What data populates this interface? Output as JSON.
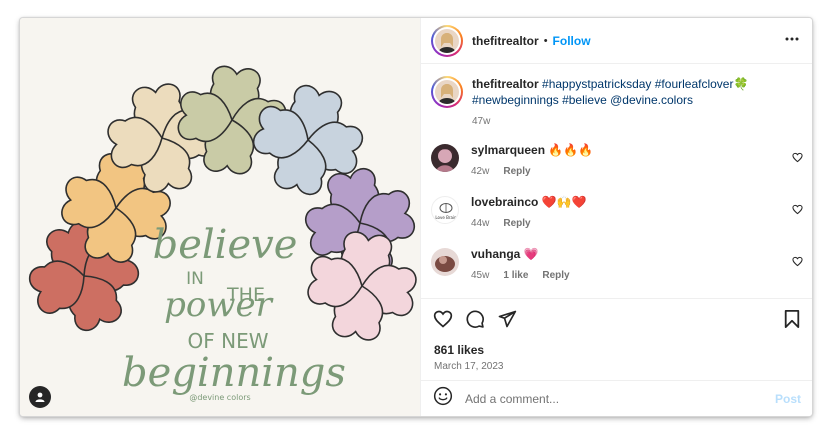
{
  "post": {
    "username": "thefitrealtor",
    "follow_label": "Follow",
    "dot": "•"
  },
  "caption": {
    "username": "thefitrealtor",
    "text": "#happystpatricksday #fourleafclover🍀 #newbeginnings #believe @devine.colors",
    "age": "47w"
  },
  "comments": [
    {
      "username": "sylmarqueen",
      "text": "🔥🔥🔥",
      "age": "42w",
      "likes": "",
      "reply_label": "Reply"
    },
    {
      "username": "lovebrainco",
      "text": "❤️🙌❤️",
      "age": "44w",
      "likes": "",
      "reply_label": "Reply",
      "avatar_text": "Love Brain"
    },
    {
      "username": "vuhanga",
      "text": "💗",
      "age": "45w",
      "likes": "1 like",
      "reply_label": "Reply"
    }
  ],
  "stats": {
    "likes": "861 likes",
    "date": "March 17, 2023"
  },
  "composer": {
    "placeholder": "Add a comment...",
    "post_label": "Post"
  },
  "artwork": {
    "line1": "believe",
    "line2_a": "IN",
    "line2_b": "THE",
    "line3": "power",
    "line4": "OF NEW",
    "line5": "beginnings",
    "credit": "@devine colors",
    "clover_colors": [
      "#cd6f62",
      "#f2c582",
      "#ecdcbd",
      "#c9cba6",
      "#c8d3de",
      "#b59ec9",
      "#f3d6dc"
    ],
    "text_color": "#7c9a78"
  },
  "icons": {
    "more": "more-horizontal-icon",
    "like": "heart-icon",
    "comment": "comment-icon",
    "share": "share-icon",
    "save": "bookmark-icon",
    "emoji": "emoji-icon",
    "user_tag": "user-tag-icon"
  },
  "colors": {
    "link": "#0095f6",
    "hashtag": "#00376b",
    "muted": "#737373"
  }
}
